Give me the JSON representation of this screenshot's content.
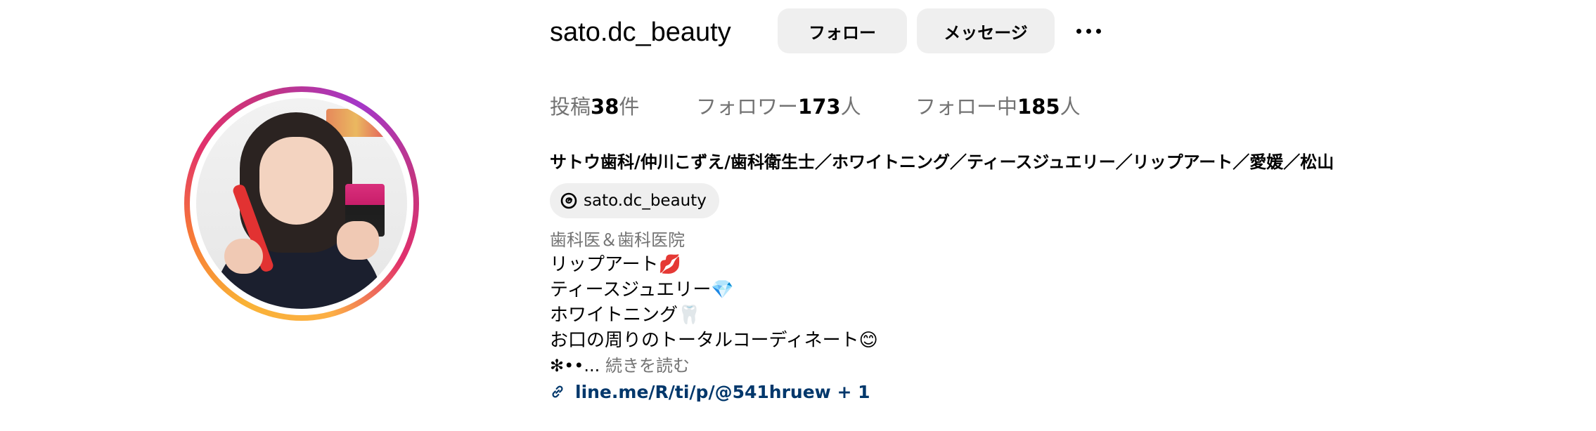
{
  "profile": {
    "username": "sato.dc_beauty",
    "follow_label": "フォロー",
    "message_label": "メッセージ",
    "stats": {
      "posts_prefix": "投稿",
      "posts_count": "38",
      "posts_suffix": "件",
      "followers_prefix": "フォロワー",
      "followers_count": "173",
      "followers_suffix": "人",
      "following_prefix": "フォロー中",
      "following_count": "185",
      "following_suffix": "人"
    },
    "full_name": "サトウ歯科/仲川こずえ/歯科衛生士／ホワイトニング／ティースジュエリー／リップアート／愛媛／松山",
    "threads_handle": "sato.dc_beauty",
    "category": "歯科医＆歯科医院",
    "bio": [
      "リップアート💋",
      "ティースジュエリー💎",
      "ホワイトニング🦷",
      "お口の周りのトータルコーディネート😊"
    ],
    "bio_truncated": "✻••...",
    "read_more": "続きを読む",
    "link_text": "line.me/R/ti/p/@541hruew + 1"
  },
  "colors": {
    "button_bg": "#efefef",
    "secondary_text": "#737373",
    "link": "#00376b"
  },
  "icons": [
    "more-options-icon",
    "threads-icon",
    "link-icon"
  ]
}
